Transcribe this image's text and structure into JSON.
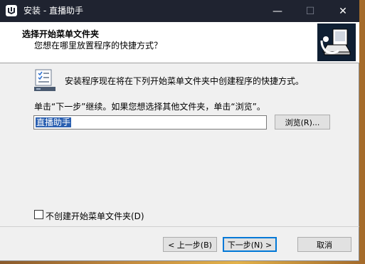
{
  "window": {
    "title": "安装 - 直播助手",
    "controls": {
      "minimize": "—",
      "maximize": "☐",
      "close": "✕"
    }
  },
  "header": {
    "title": "选择开始菜单文件夹",
    "subtitle": "您想在哪里放置程序的快捷方式？",
    "image_icon": "installer-computer-icon"
  },
  "body": {
    "icon": "start-menu-folder-icon",
    "instruction": "安装程序现在将在下列开始菜单文件夹中创建程序的快捷方式。",
    "continue_text": "单击“下一步”继续。如果您想选择其他文件夹，单击“浏览”。",
    "folder_value": "直播助手",
    "browse_label": "浏览(R)..."
  },
  "options": {
    "no_start_menu_label": "不创建开始菜单文件夹(D)",
    "no_start_menu_checked": false
  },
  "footer": {
    "back_label": "< 上一步(B)",
    "next_label": "下一步(N) >",
    "cancel_label": "取消"
  },
  "colors": {
    "titlebar": "#1f2330",
    "selection": "#2a5fb0",
    "default_button_border": "#0078d7"
  }
}
